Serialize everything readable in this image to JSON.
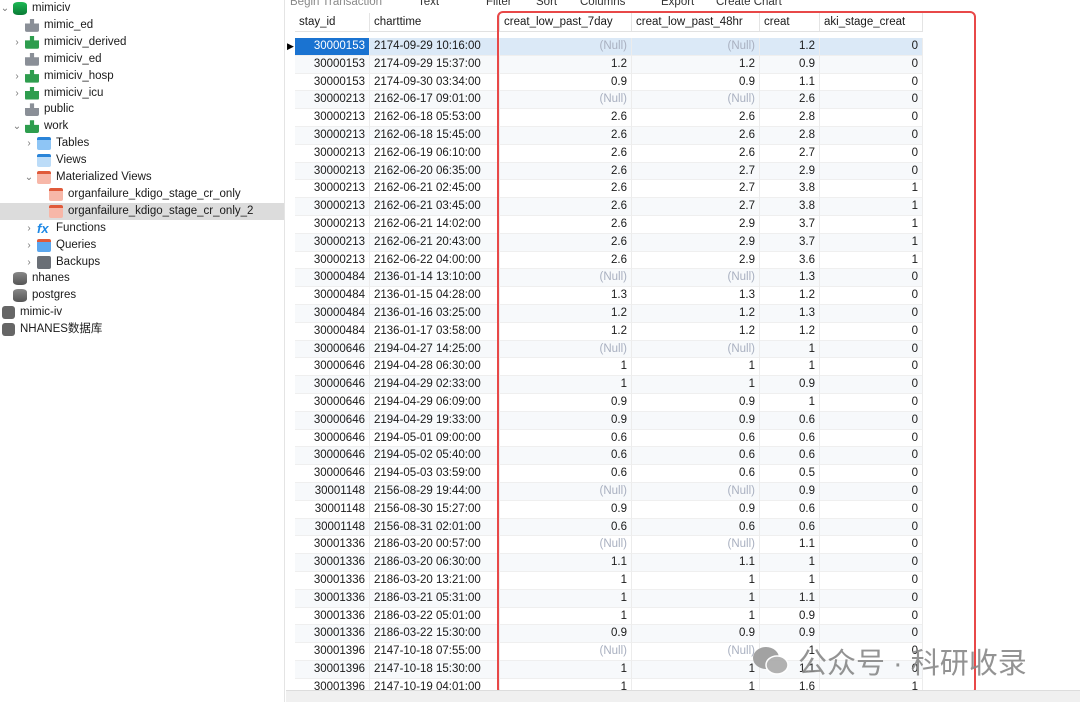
{
  "sidebar": {
    "items": [
      {
        "label": "mimiciv",
        "icon": "database-green-icon",
        "expanded": true
      },
      {
        "label": "mimic_ed",
        "icon": "schema-gray-icon"
      },
      {
        "label": "mimiciv_derived",
        "icon": "schema-green-icon",
        "collapsed": true
      },
      {
        "label": "mimiciv_ed",
        "icon": "schema-gray-icon"
      },
      {
        "label": "mimiciv_hosp",
        "icon": "schema-green-icon",
        "collapsed": true
      },
      {
        "label": "mimiciv_icu",
        "icon": "schema-green-icon",
        "collapsed": true
      },
      {
        "label": "public",
        "icon": "schema-gray-icon"
      },
      {
        "label": "work",
        "icon": "schema-green-icon",
        "expanded": true
      },
      {
        "label": "Tables",
        "icon": "tables-icon",
        "collapsed": true
      },
      {
        "label": "Views",
        "icon": "views-icon"
      },
      {
        "label": "Materialized Views",
        "icon": "materialized-views-icon",
        "expanded": true
      },
      {
        "label": "organfailure_kdigo_stage_cr_only",
        "icon": "materialized-view-icon"
      },
      {
        "label": "organfailure_kdigo_stage_cr_only_2",
        "icon": "materialized-view-icon",
        "selected": true
      },
      {
        "label": "Functions",
        "icon": "function-icon",
        "collapsed": true
      },
      {
        "label": "Queries",
        "icon": "queries-icon",
        "collapsed": true
      },
      {
        "label": "Backups",
        "icon": "backups-icon",
        "collapsed": true
      },
      {
        "label": "nhanes",
        "icon": "database-gray-icon"
      },
      {
        "label": "postgres",
        "icon": "database-gray-icon"
      },
      {
        "label": "mimic-iv",
        "icon": "postgresql-connection-icon"
      },
      {
        "label": "NHANES数据库",
        "icon": "postgresql-connection-icon"
      }
    ]
  },
  "toolbar": {
    "begin_transaction": "Begin Transaction",
    "text": "Text",
    "filter": "Filter",
    "sort": "Sort",
    "columns": "Columns",
    "export": "Export",
    "create_chart": "Create Chart"
  },
  "table": {
    "columns": [
      "stay_id",
      "charttime",
      "creat_low_past_7day",
      "creat_low_past_48hr",
      "creat",
      "aki_stage_creat"
    ],
    "rows": [
      [
        "30000153",
        "2174-09-29 10:16:00",
        "(Null)",
        "(Null)",
        "1.2",
        "0"
      ],
      [
        "30000153",
        "2174-09-29 15:37:00",
        "1.2",
        "1.2",
        "0.9",
        "0"
      ],
      [
        "30000153",
        "2174-09-30 03:34:00",
        "0.9",
        "0.9",
        "1.1",
        "0"
      ],
      [
        "30000213",
        "2162-06-17 09:01:00",
        "(Null)",
        "(Null)",
        "2.6",
        "0"
      ],
      [
        "30000213",
        "2162-06-18 05:53:00",
        "2.6",
        "2.6",
        "2.8",
        "0"
      ],
      [
        "30000213",
        "2162-06-18 15:45:00",
        "2.6",
        "2.6",
        "2.8",
        "0"
      ],
      [
        "30000213",
        "2162-06-19 06:10:00",
        "2.6",
        "2.6",
        "2.7",
        "0"
      ],
      [
        "30000213",
        "2162-06-20 06:35:00",
        "2.6",
        "2.7",
        "2.9",
        "0"
      ],
      [
        "30000213",
        "2162-06-21 02:45:00",
        "2.6",
        "2.7",
        "3.8",
        "1"
      ],
      [
        "30000213",
        "2162-06-21 03:45:00",
        "2.6",
        "2.7",
        "3.8",
        "1"
      ],
      [
        "30000213",
        "2162-06-21 14:02:00",
        "2.6",
        "2.9",
        "3.7",
        "1"
      ],
      [
        "30000213",
        "2162-06-21 20:43:00",
        "2.6",
        "2.9",
        "3.7",
        "1"
      ],
      [
        "30000213",
        "2162-06-22 04:00:00",
        "2.6",
        "2.9",
        "3.6",
        "1"
      ],
      [
        "30000484",
        "2136-01-14 13:10:00",
        "(Null)",
        "(Null)",
        "1.3",
        "0"
      ],
      [
        "30000484",
        "2136-01-15 04:28:00",
        "1.3",
        "1.3",
        "1.2",
        "0"
      ],
      [
        "30000484",
        "2136-01-16 03:25:00",
        "1.2",
        "1.2",
        "1.3",
        "0"
      ],
      [
        "30000484",
        "2136-01-17 03:58:00",
        "1.2",
        "1.2",
        "1.2",
        "0"
      ],
      [
        "30000646",
        "2194-04-27 14:25:00",
        "(Null)",
        "(Null)",
        "1",
        "0"
      ],
      [
        "30000646",
        "2194-04-28 06:30:00",
        "1",
        "1",
        "1",
        "0"
      ],
      [
        "30000646",
        "2194-04-29 02:33:00",
        "1",
        "1",
        "0.9",
        "0"
      ],
      [
        "30000646",
        "2194-04-29 06:09:00",
        "0.9",
        "0.9",
        "1",
        "0"
      ],
      [
        "30000646",
        "2194-04-29 19:33:00",
        "0.9",
        "0.9",
        "0.6",
        "0"
      ],
      [
        "30000646",
        "2194-05-01 09:00:00",
        "0.6",
        "0.6",
        "0.6",
        "0"
      ],
      [
        "30000646",
        "2194-05-02 05:40:00",
        "0.6",
        "0.6",
        "0.6",
        "0"
      ],
      [
        "30000646",
        "2194-05-03 03:59:00",
        "0.6",
        "0.6",
        "0.5",
        "0"
      ],
      [
        "30001148",
        "2156-08-29 19:44:00",
        "(Null)",
        "(Null)",
        "0.9",
        "0"
      ],
      [
        "30001148",
        "2156-08-30 15:27:00",
        "0.9",
        "0.9",
        "0.6",
        "0"
      ],
      [
        "30001148",
        "2156-08-31 02:01:00",
        "0.6",
        "0.6",
        "0.6",
        "0"
      ],
      [
        "30001336",
        "2186-03-20 00:57:00",
        "(Null)",
        "(Null)",
        "1.1",
        "0"
      ],
      [
        "30001336",
        "2186-03-20 06:30:00",
        "1.1",
        "1.1",
        "1",
        "0"
      ],
      [
        "30001336",
        "2186-03-20 13:21:00",
        "1",
        "1",
        "1",
        "0"
      ],
      [
        "30001336",
        "2186-03-21 05:31:00",
        "1",
        "1",
        "1.1",
        "0"
      ],
      [
        "30001336",
        "2186-03-22 05:01:00",
        "1",
        "1",
        "0.9",
        "0"
      ],
      [
        "30001336",
        "2186-03-22 15:30:00",
        "0.9",
        "0.9",
        "0.9",
        "0"
      ],
      [
        "30001396",
        "2147-10-18 07:55:00",
        "(Null)",
        "(Null)",
        "1",
        "0"
      ],
      [
        "30001396",
        "2147-10-18 15:30:00",
        "1",
        "1",
        "1.1",
        "0"
      ],
      [
        "30001396",
        "2147-10-19 04:01:00",
        "1",
        "1",
        "1.6",
        "1"
      ]
    ]
  },
  "watermark": {
    "text": "公众号 · 科研收录"
  },
  "colors": {
    "highlight_box": "#e84848",
    "selection": "#1a73d1",
    "null_text": "#a9b0c0"
  }
}
